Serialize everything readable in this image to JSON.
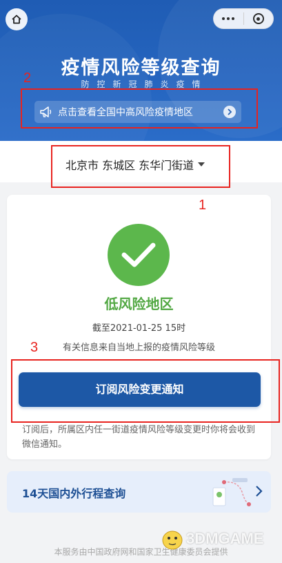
{
  "header": {
    "title": "疫情风险等级查询",
    "subtitle": "防控新冠肺炎疫情",
    "notice_text": "点击查看全国中高风险疫情地区"
  },
  "location": {
    "label": "北京市 东城区 东华门街道"
  },
  "card": {
    "risk_level": "低风险地区",
    "deadline": "截至2021-01-25 15时",
    "source": "有关信息来自当地上报的疫情风险等级",
    "subscribe_label": "订阅风险变更通知",
    "subscribe_note": "订阅后，所属区内任一街道疫情风险等级变更时你将会收到微信通知。"
  },
  "travel": {
    "label": "14天国内外行程查询"
  },
  "footer": {
    "text": "本服务由中国政府网和国家卫生健康委员会提供"
  },
  "watermark": {
    "text": "3DMGAME"
  },
  "annotations": {
    "n1": "1",
    "n2": "2",
    "n3": "3"
  },
  "colors": {
    "header_blue": "#2a6cc8",
    "button_blue": "#1d58a6",
    "low_risk_green": "#5cb74c",
    "annotation_red": "#e8231f"
  },
  "icons": [
    "home-icon",
    "more-dots-icon",
    "close-target-icon",
    "megaphone-icon",
    "chevron-right-icon",
    "check-shield-icon",
    "map-route-icon",
    "mascot-icon"
  ]
}
